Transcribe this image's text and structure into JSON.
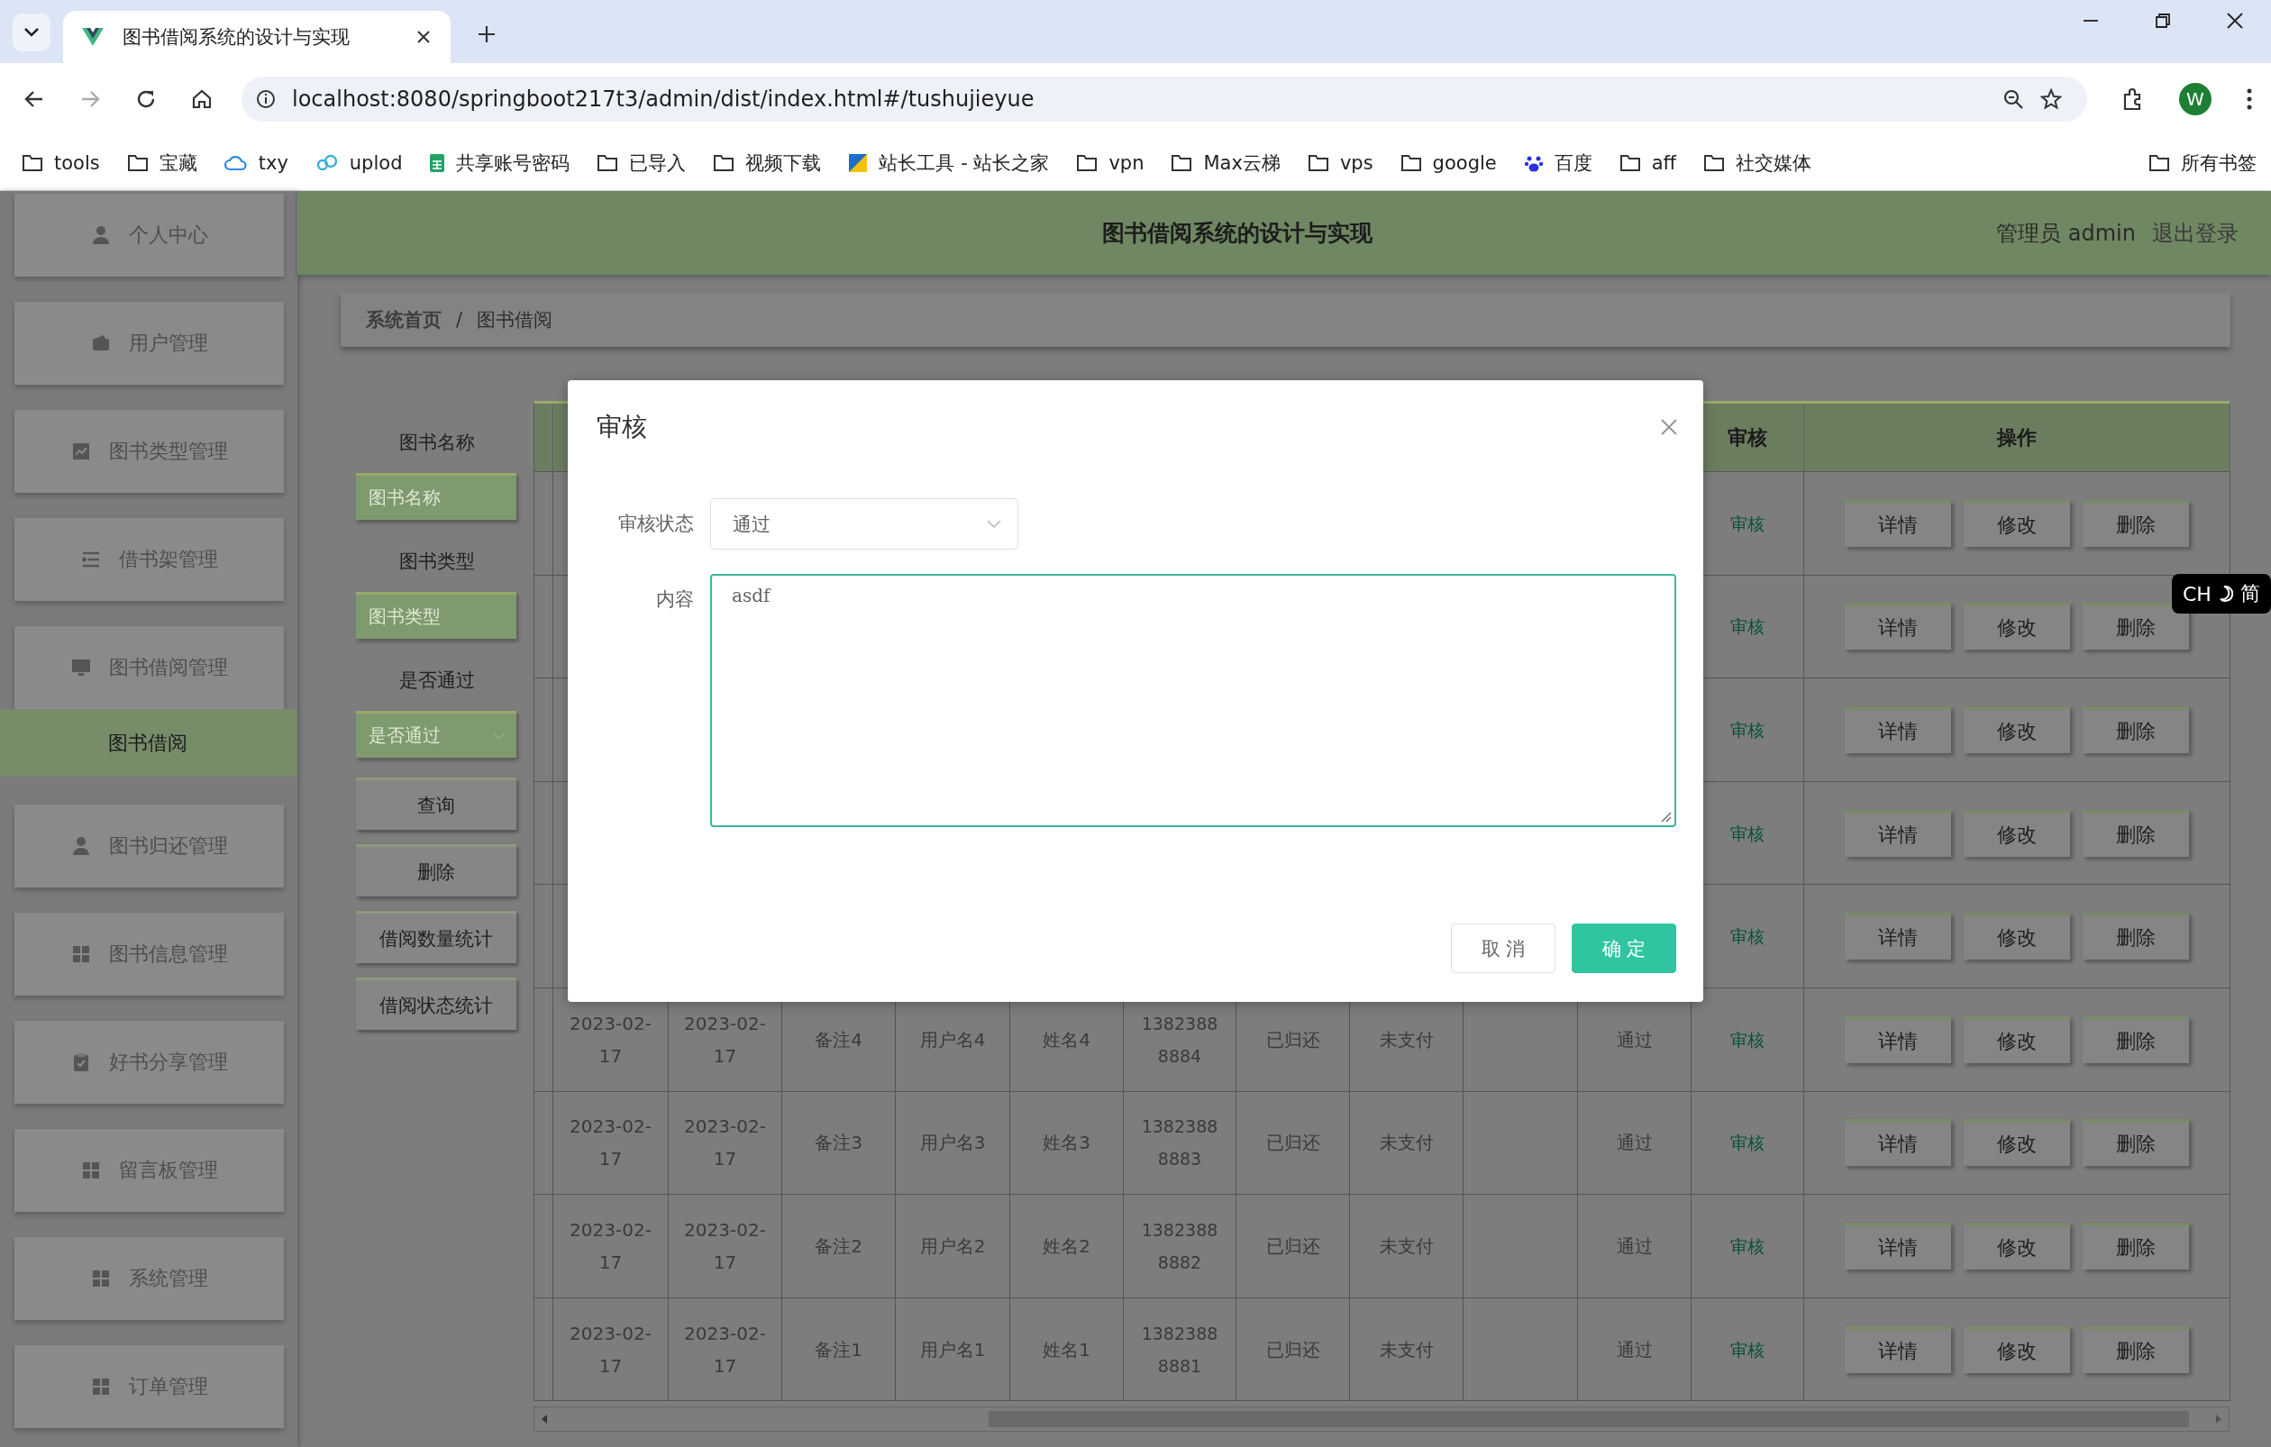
{
  "browser": {
    "tab": {
      "title": "图书借阅系统的设计与实现"
    },
    "address": "localhost:8080/springboot217t3/admin/dist/index.html#/tushujieyue",
    "profile": "W",
    "bookmarks": [
      {
        "label": "tools",
        "kind": "folder"
      },
      {
        "label": "宝藏",
        "kind": "folder"
      },
      {
        "label": "txy",
        "kind": "cloud"
      },
      {
        "label": "uplod",
        "kind": "link"
      },
      {
        "label": "共享账号密码",
        "kind": "sheet"
      },
      {
        "label": "已导入",
        "kind": "folder"
      },
      {
        "label": "视频下载",
        "kind": "folder"
      },
      {
        "label": "站长工具 - 站长之家",
        "kind": "site"
      },
      {
        "label": "vpn",
        "kind": "folder"
      },
      {
        "label": "Max云梯",
        "kind": "folder"
      },
      {
        "label": "vps",
        "kind": "folder"
      },
      {
        "label": "google",
        "kind": "folder"
      },
      {
        "label": "百度",
        "kind": "paw"
      },
      {
        "label": "aff",
        "kind": "folder"
      },
      {
        "label": "社交媒体",
        "kind": "folder"
      }
    ],
    "all_bookmarks": "所有书签"
  },
  "header": {
    "title": "图书借阅系统的设计与实现",
    "user": "管理员 admin",
    "logout": "退出登录"
  },
  "sidebar": {
    "items": [
      {
        "label": "个人中心",
        "selected": false,
        "expanded": false
      },
      {
        "label": "用户管理",
        "selected": false,
        "expanded": false
      },
      {
        "label": "图书类型管理",
        "selected": false,
        "expanded": false
      },
      {
        "label": "借书架管理",
        "selected": false,
        "expanded": false
      },
      {
        "label": "图书借阅管理",
        "selected": false,
        "expanded": true,
        "children": [
          {
            "label": "图书借阅",
            "selected": true
          }
        ]
      },
      {
        "label": "图书归还管理",
        "selected": false,
        "expanded": false
      },
      {
        "label": "图书信息管理",
        "selected": false,
        "expanded": false
      },
      {
        "label": "好书分享管理",
        "selected": false,
        "expanded": false
      },
      {
        "label": "留言板管理",
        "selected": false,
        "expanded": false
      },
      {
        "label": "系统管理",
        "selected": false,
        "expanded": false
      },
      {
        "label": "订单管理",
        "selected": false,
        "expanded": false
      }
    ]
  },
  "breadcrumb": {
    "items": [
      "系统首页",
      "图书借阅"
    ],
    "separator": "/"
  },
  "search": {
    "fields": [
      {
        "label": "图书名称",
        "placeholder": "图书名称",
        "kind": "input"
      },
      {
        "label": "图书类型",
        "placeholder": "图书类型",
        "kind": "input"
      },
      {
        "label": "是否通过",
        "placeholder": "是否通过",
        "kind": "select"
      }
    ],
    "buttons": [
      "查询",
      "删除",
      "借阅数量统计",
      "借阅状态统计"
    ]
  },
  "table": {
    "columns": [
      {
        "label": "审核"
      },
      {
        "label": "操作"
      }
    ],
    "rows": [
      {
        "audit": "审核",
        "actions": [
          "详情",
          "修改",
          "删除"
        ]
      },
      {
        "audit": "审核",
        "actions": [
          "详情",
          "修改",
          "删除"
        ]
      },
      {
        "audit": "审核",
        "actions": [
          "详情",
          "修改",
          "删除"
        ]
      },
      {
        "audit": "审核",
        "actions": [
          "详情",
          "修改",
          "删除"
        ]
      },
      {
        "audit": "审核",
        "actions": [
          "详情",
          "修改",
          "删除"
        ]
      },
      {
        "borrow_date": "2023-02-17",
        "return_date": "2023-02-17",
        "remark": "备注4",
        "username": "用户名4",
        "name": "姓名4",
        "phone": "13823888884",
        "return_status": "已归还",
        "payment": "未支付",
        "approval": "通过",
        "audit": "审核",
        "actions": [
          "详情",
          "修改",
          "删除"
        ]
      },
      {
        "borrow_date": "2023-02-17",
        "return_date": "2023-02-17",
        "remark": "备注3",
        "username": "用户名3",
        "name": "姓名3",
        "phone": "13823888883",
        "return_status": "已归还",
        "payment": "未支付",
        "approval": "通过",
        "audit": "审核",
        "actions": [
          "详情",
          "修改",
          "删除"
        ]
      },
      {
        "borrow_date": "2023-02-17",
        "return_date": "2023-02-17",
        "remark": "备注2",
        "username": "用户名2",
        "name": "姓名2",
        "phone": "13823888882",
        "return_status": "已归还",
        "payment": "未支付",
        "approval": "通过",
        "audit": "审核",
        "actions": [
          "详情",
          "修改",
          "删除"
        ]
      },
      {
        "borrow_date": "2023-02-17",
        "return_date": "2023-02-17",
        "remark": "备注1",
        "username": "用户名1",
        "name": "姓名1",
        "phone": "13823888881",
        "return_status": "已归还",
        "payment": "未支付",
        "approval": "通过",
        "audit": "审核",
        "actions": [
          "详情",
          "修改",
          "删除"
        ]
      }
    ]
  },
  "modal": {
    "title": "审核",
    "fields": [
      {
        "label": "审核状态",
        "kind": "select",
        "value": "通过"
      },
      {
        "label": "内容",
        "kind": "textarea",
        "value": "asdf"
      }
    ],
    "buttons": [
      {
        "label": "取消",
        "kind": "secondary"
      },
      {
        "label": "确定",
        "kind": "primary"
      }
    ]
  },
  "ime": {
    "mode": "CH",
    "script": "简"
  }
}
